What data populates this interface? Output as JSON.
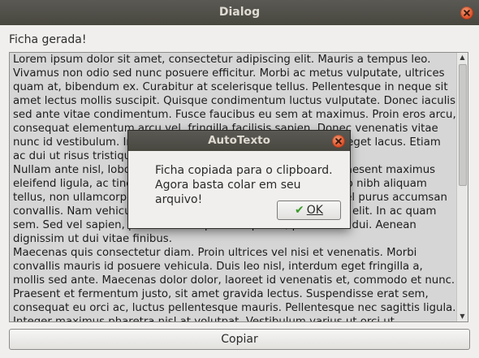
{
  "window": {
    "title": "Dialog"
  },
  "heading": "Ficha gerada!",
  "body_text": "Lorem ipsum dolor sit amet, consectetur adipiscing elit. Mauris a tempus leo. Vivamus non odio sed nunc posuere efficitur. Morbi ac metus vulputate, ultrices quam at, bibendum ex. Curabitur at scelerisque tellus. Pellentesque in neque sit amet lectus mollis suscipit. Quisque condimentum luctus vulputate. Donec iaculis sed ante vitae condimentum. Fusce faucibus eu sem at maximus. Proin eros arcu, consequat elementum arcu vel, fringilla facilisis sapien. Donec venenatis vitae nunc id vestibulum. Integer pulvinar lobortis tortor congue id eget lacus. Etiam ac dui ut risus tristique efficitur nec a diam.\nNullam ante nisl, lobortis vel nibh vel, blandit posuere orci. Praesent maximus eleifend ligula, ac tincidunt nulla. Donec convallis cursus, justo nibh aliquam tellus, non ullamcorper lorem nisi vitae nunc molestie lacus vel purus accumsan convallis. Nam vehicula, nisl id tempus consectetur adipiscing elit. In ac quam sem. Sed vel sapien, placerat tristique volutpat ac, pretium at dui. Aenean dignissim ut dui vitae finibus.\nMaecenas quis consectetur diam. Proin ultrices vel nisi et venenatis. Morbi convallis mauris id posuere vehicula. Duis leo nisl, interdum eget fringilla a, mollis sed ante. Maecenas dolor dolor, laoreet id venenatis et, commodo et nunc. Praesent et fermentum justo, sit amet gravida lectus. Suspendisse erat sem, consequat eu orci ac, luctus pellentesque mauris. Pellentesque nec sagittis ligula. Integer maximus pharetra nisl at volutpat. Vestibulum varius ut orci ut",
  "copy_button": "Copiar",
  "modal": {
    "title": "AutoTexto",
    "line1": "Ficha copiada para o clipboard.",
    "line2": "Agora basta colar em seu arquivo!",
    "ok_label": "OK"
  },
  "icons": {
    "close": "close-icon",
    "check": "check-icon",
    "scroll_up": "arrow-up-icon",
    "scroll_down": "arrow-down-icon"
  },
  "colors": {
    "titlebar": "#4f4e49",
    "close_button": "#e0542c",
    "textarea_bg": "#d6d6d6",
    "window_bg": "#f0efed"
  }
}
